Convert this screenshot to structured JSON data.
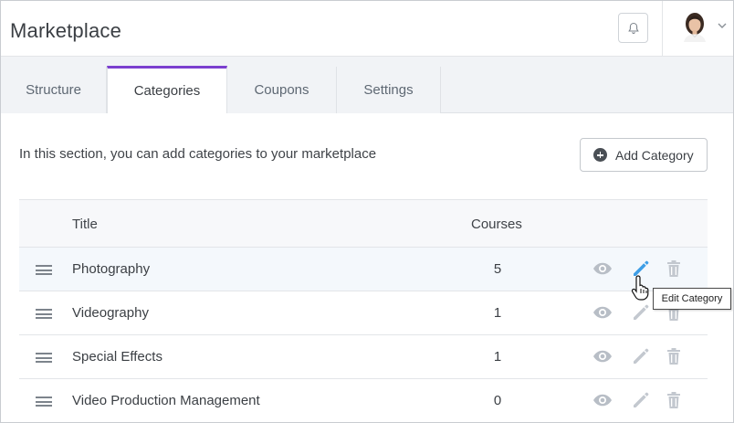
{
  "header": {
    "title": "Marketplace",
    "bell_icon": "bell-icon",
    "avatar": "user-avatar",
    "menu_icon": "chevron-down-icon"
  },
  "tabs": [
    {
      "label": "Structure",
      "active": false
    },
    {
      "label": "Categories",
      "active": true
    },
    {
      "label": "Coupons",
      "active": false
    },
    {
      "label": "Settings",
      "active": false
    }
  ],
  "content": {
    "intro": "In this section, you can add categories to your marketplace",
    "add_button_label": "Add Category"
  },
  "table": {
    "columns": [
      "Title",
      "Courses"
    ],
    "rows": [
      {
        "title": "Photography",
        "courses": "5"
      },
      {
        "title": "Videography",
        "courses": "1"
      },
      {
        "title": "Special Effects",
        "courses": "1"
      },
      {
        "title": "Video Production Management",
        "courses": "0"
      }
    ]
  },
  "tooltip": "Edit Category",
  "colors": {
    "accent": "#7b3fcf",
    "edit_active": "#3e9ee6",
    "icon_muted": "#c3c8cf",
    "view_icon": "#b8bec6"
  }
}
